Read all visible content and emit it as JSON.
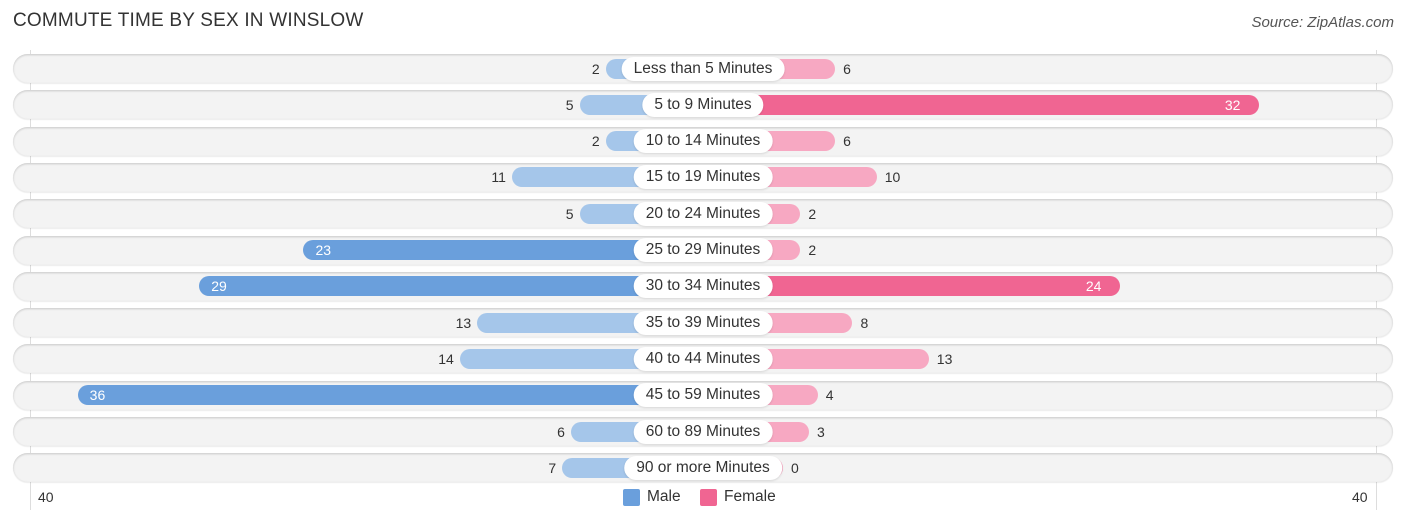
{
  "title": "COMMUTE TIME BY SEX IN WINSLOW",
  "source": "Source: ZipAtlas.com",
  "colors": {
    "male_strong": "#6a9fdc",
    "male_light": "#a5c6ea",
    "female_strong": "#f06592",
    "female_light": "#f7a8c2"
  },
  "chart_data": {
    "type": "bar",
    "orientation": "horizontal-diverging",
    "title": "COMMUTE TIME BY SEX IN WINSLOW",
    "categories": [
      "Less than 5 Minutes",
      "5 to 9 Minutes",
      "10 to 14 Minutes",
      "15 to 19 Minutes",
      "20 to 24 Minutes",
      "25 to 29 Minutes",
      "30 to 34 Minutes",
      "35 to 39 Minutes",
      "40 to 44 Minutes",
      "45 to 59 Minutes",
      "60 to 89 Minutes",
      "90 or more Minutes"
    ],
    "series": [
      {
        "name": "Male",
        "values": [
          2,
          5,
          2,
          11,
          5,
          23,
          29,
          13,
          14,
          36,
          6,
          7
        ]
      },
      {
        "name": "Female",
        "values": [
          6,
          32,
          6,
          10,
          2,
          2,
          24,
          8,
          13,
          4,
          3,
          0
        ]
      }
    ],
    "axis": {
      "left_label": "40",
      "right_label": "40",
      "range": [
        0,
        40
      ]
    },
    "legend": {
      "position": "bottom-center",
      "items": [
        "Male",
        "Female"
      ]
    }
  }
}
